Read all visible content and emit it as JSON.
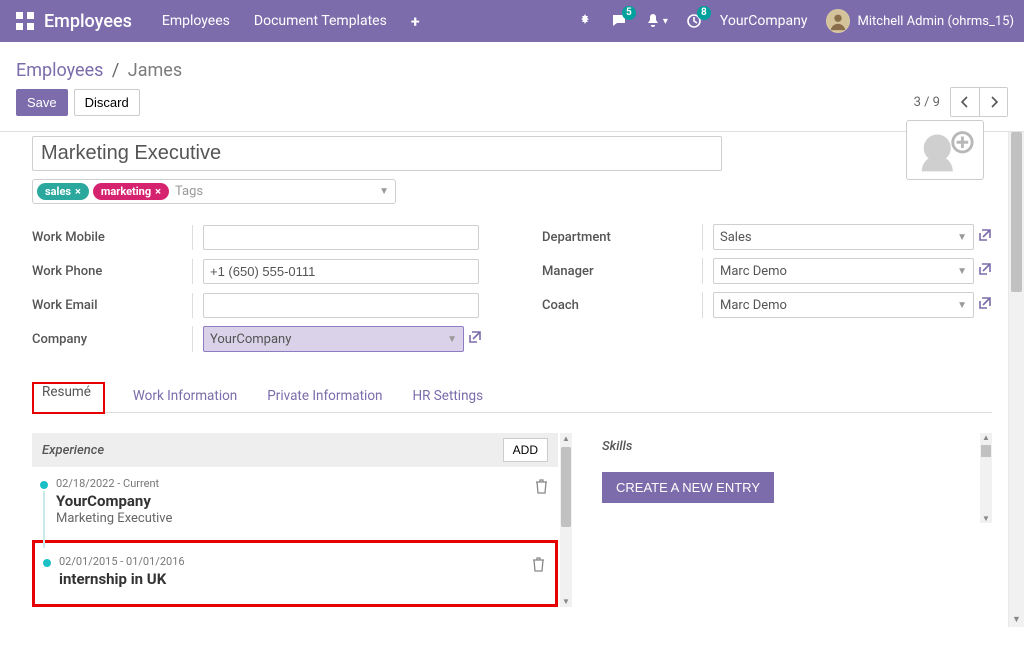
{
  "navbar": {
    "brand": "Employees",
    "links": [
      "Employees",
      "Document Templates"
    ],
    "msg_count": "5",
    "act_count": "8",
    "company": "YourCompany",
    "user": "Mitchell Admin (ohrms_15)"
  },
  "breadcrumb": {
    "root": "Employees",
    "current": "James"
  },
  "actions": {
    "save": "Save",
    "discard": "Discard"
  },
  "pager": {
    "text": "3 / 9"
  },
  "form": {
    "job_title": "Marketing Executive",
    "tags": [
      "sales",
      "marketing"
    ],
    "tags_placeholder": "Tags",
    "labels": {
      "work_mobile": "Work Mobile",
      "work_phone": "Work Phone",
      "work_email": "Work Email",
      "company": "Company",
      "department": "Department",
      "manager": "Manager",
      "coach": "Coach"
    },
    "values": {
      "work_mobile": "",
      "work_phone": "+1 (650) 555-0111",
      "work_email": "",
      "company": "YourCompany",
      "department": "Sales",
      "manager": "Marc Demo",
      "coach": "Marc Demo"
    }
  },
  "tabs": {
    "resume": "Resumé",
    "work_info": "Work Information",
    "private_info": "Private Information",
    "hr_settings": "HR Settings"
  },
  "resume": {
    "exp_heading": "Experience",
    "add_label": "ADD",
    "entries": [
      {
        "dates": "02/18/2022 - Current",
        "title": "YourCompany",
        "subtitle": "Marketing Executive"
      },
      {
        "dates": "02/01/2015 - 01/01/2016",
        "title": "internship in UK",
        "subtitle": ""
      }
    ],
    "skills_heading": "Skills",
    "create_entry": "CREATE A NEW ENTRY"
  }
}
